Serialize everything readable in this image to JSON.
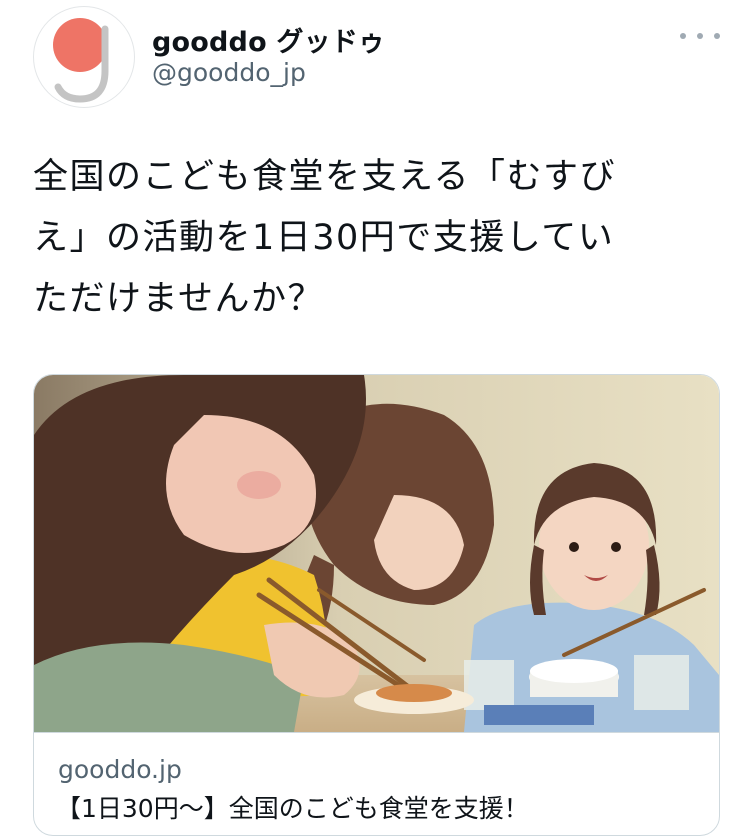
{
  "account": {
    "display_name": "gooddo グッドゥ",
    "handle": "@gooddo_jp",
    "avatar_icon": "gooddo-logo-icon"
  },
  "more_icon": "more-horizontal-icon",
  "tweet": {
    "lines": [
      "全国のこども食堂を支える「むすび",
      "え」の活動を1日30円で支援してい",
      "ただけませんか？"
    ]
  },
  "card": {
    "image_alt": "children-eating-illustration",
    "domain": "gooddo.jp",
    "title": "【1日30円〜】全国のこども食堂を支援！"
  },
  "colors": {
    "avatar_red": "#ee7466",
    "avatar_gray": "#c4c4c4",
    "secondary_text": "#536471",
    "border": "#cfd9de"
  }
}
